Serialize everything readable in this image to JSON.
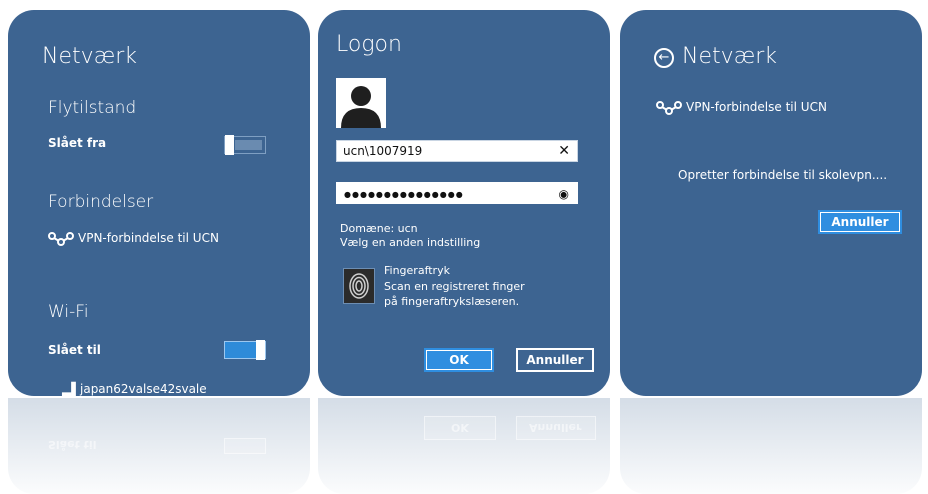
{
  "panel1": {
    "title": "Netværk",
    "airplane_heading": "Flytilstand",
    "airplane_state": "Slået fra",
    "connections_heading": "Forbindelser",
    "vpn_name": "VPN-forbindelse til UCN",
    "wifi_heading": "Wi-Fi",
    "wifi_state": "Slået til",
    "network_name": "japan62valse42svale"
  },
  "panel2": {
    "title": "Logon",
    "username": "ucn\\1007919",
    "password_mask": "●●●●●●●●●●●●●●●",
    "clear_glyph": "✕",
    "reveal_glyph": "◉",
    "domain_text": "Domæne: ucn",
    "other_option": "Vælg en anden indstilling",
    "fingerprint_title": "Fingeraftryk",
    "fingerprint_desc1": "Scan en registreret finger",
    "fingerprint_desc2": "på fingeraftrykslæseren.",
    "ok_label": "OK",
    "cancel_label": "Annuller"
  },
  "panel3": {
    "title": "Netværk",
    "back_glyph": "←",
    "vpn_name": "VPN-forbindelse til UCN",
    "status": "Opretter forbindelse til skolevpn....",
    "cancel_label": "Annuller"
  },
  "reflection": {
    "ok": "OK",
    "cancel": "Annuller",
    "state": "Slået til"
  }
}
